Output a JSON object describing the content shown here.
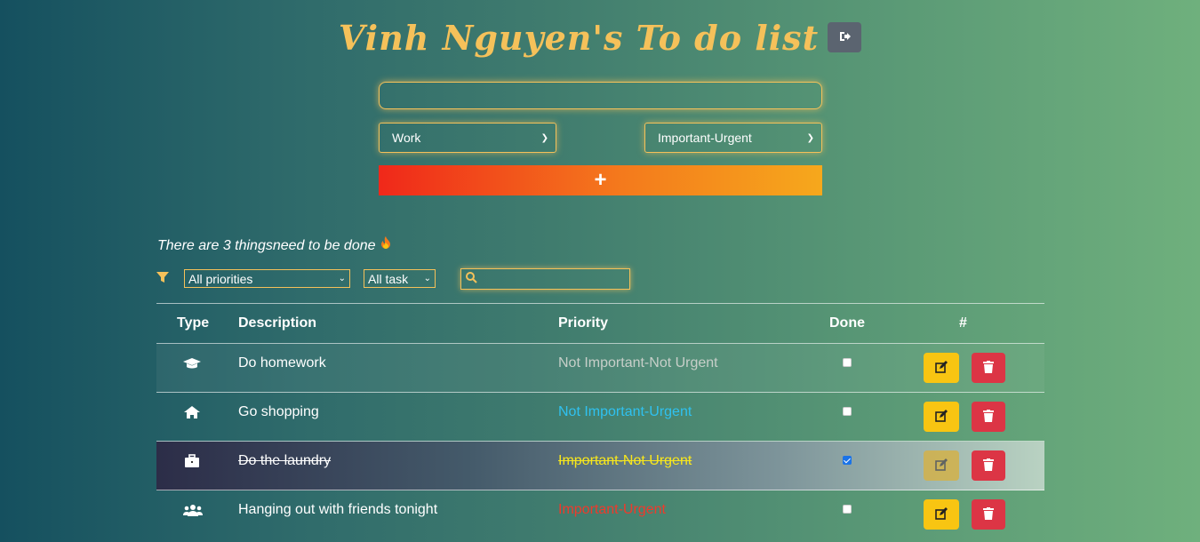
{
  "header": {
    "title": "Vinh Nguyen's To do list",
    "logout_icon": "sign-out-icon"
  },
  "form": {
    "task_input_value": "",
    "type_select": "Work",
    "priority_select": "Important-Urgent",
    "add_label": "+"
  },
  "summary": {
    "text": "There are 3 thingsneed to be done",
    "emoji_icon": "fire-icon"
  },
  "filters": {
    "filter_icon": "filter-icon",
    "priority_filter": "All priorities",
    "status_filter": "All task",
    "search_value": "",
    "search_icon": "search-icon"
  },
  "table": {
    "headers": {
      "type": "Type",
      "description": "Description",
      "priority": "Priority",
      "done": "Done",
      "actions": "#"
    },
    "rows": [
      {
        "type_icon": "graduation-cap-icon",
        "description": "Do homework",
        "priority": "Not Important-Not Urgent",
        "priority_color": "#c7cfc9",
        "done": false
      },
      {
        "type_icon": "home-icon",
        "description": "Go shopping",
        "priority": "Not Important-Urgent",
        "priority_color": "#2fc1f0",
        "done": false
      },
      {
        "type_icon": "briefcase-icon",
        "description": "Do the laundry",
        "priority": "Important-Not Urgent",
        "priority_color": "#f8e71c",
        "done": true
      },
      {
        "type_icon": "users-icon",
        "description": "Hanging out with friends tonight",
        "priority": "Important-Urgent",
        "priority_color": "#f0392b",
        "done": false
      }
    ]
  },
  "colors": {
    "accent": "#f5c15a",
    "edit": "#f8c512",
    "delete": "#dc3545"
  }
}
